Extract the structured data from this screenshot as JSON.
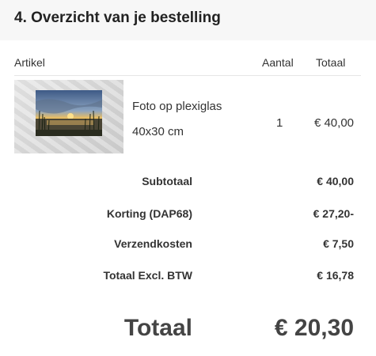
{
  "section": {
    "title": "4. Overzicht van je bestelling"
  },
  "table": {
    "headers": {
      "article": "Artikel",
      "quantity": "Aantal",
      "total": "Totaal"
    },
    "items": [
      {
        "name": "Foto op plexiglas",
        "size": "40x30 cm",
        "quantity": "1",
        "price": "€ 40,00"
      }
    ]
  },
  "summary": {
    "subtotal_label": "Subtotaal",
    "subtotal_value": "€ 40,00",
    "discount_label": "Korting (DAP68)",
    "discount_value": "€ 27,20-",
    "shipping_label": "Verzendkosten",
    "shipping_value": "€ 7,50",
    "excl_label": "Totaal Excl. BTW",
    "excl_value": "€ 16,78"
  },
  "grand_total": {
    "label": "Totaal",
    "value": "€ 20,30"
  }
}
